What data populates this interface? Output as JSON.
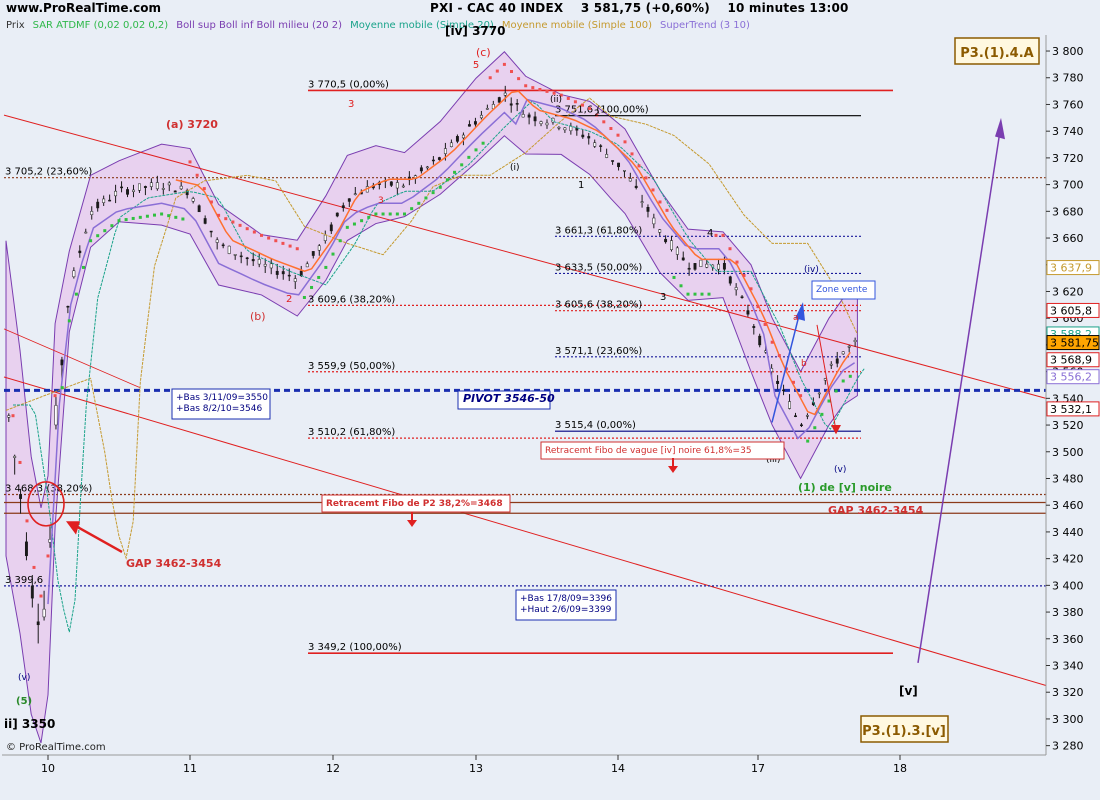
{
  "header": {
    "site": "www.ProRealTime.com",
    "symbol": "PXI - CAC 40 INDEX",
    "price_change": "3 581,75 (+0,60%)",
    "timeframe": "10 minutes 13:00"
  },
  "legend": [
    {
      "label": "Prix",
      "color": "#333333"
    },
    {
      "label": "SAR ATDMF (0,02 0,02 0,2)",
      "color": "#2fb84a"
    },
    {
      "label": "Boll sup Boll inf Boll milieu (20 2)",
      "color": "#7a3db0"
    },
    {
      "label": "Moyenne mobile (Simple 20)",
      "color": "#1aa38a"
    },
    {
      "label": "Moyenne mobile (Simple 100)",
      "color": "#c59a2f"
    },
    {
      "label": "SuperTrend (3 10)",
      "color": "#8a6fd6"
    }
  ],
  "colors": {
    "background": "#e9eef6",
    "candle": "#1a1a1a",
    "fibo_red": "#e02020",
    "fibo_blue": "#1a1a9a",
    "sar_red": "#f05050",
    "sar_green": "#30c040",
    "bollinger_fill": "#e7c9ee",
    "bollinger_line": "#7a3db0",
    "supertrend": "#8a6fd6",
    "ma20": "#1aa38a",
    "ma100": "#c59a2f",
    "price_line": "#ff7030"
  },
  "copyright": "© ProRealTime.com",
  "chart_data": {
    "type": "candlestick",
    "title": "PXI - CAC 40 INDEX",
    "xlabel": "",
    "ylabel": "",
    "x_ticks": [
      "10",
      "11",
      "12",
      "13",
      "14",
      "17",
      "18"
    ],
    "y_ticks": [
      3280,
      3300,
      3320,
      3340,
      3360,
      3380,
      3400,
      3420,
      3440,
      3460,
      3480,
      3500,
      3520,
      3540,
      3560,
      3580,
      3600,
      3620,
      3640,
      3660,
      3680,
      3700,
      3720,
      3740,
      3760,
      3780,
      3800
    ],
    "y_tick_labels": [
      "3 280",
      "3 300",
      "3 320",
      "3 340",
      "3 360",
      "3 380",
      "3 400",
      "3 420",
      "3 440",
      "3 460",
      "3 480",
      "3 500",
      "3 520",
      "3 540",
      "3 560",
      "3 580",
      "3 600",
      "3 620",
      "3 640",
      "3 660",
      "3 680",
      "3 700",
      "3 720",
      "3 740",
      "3 760",
      "3 780",
      "3 800"
    ],
    "ylim": [
      3273,
      3812
    ],
    "grid": false,
    "price_path": [
      [
        9.7,
        3540
      ],
      [
        9.8,
        3470
      ],
      [
        9.88,
        3400
      ],
      [
        9.95,
        3370
      ],
      [
        10.0,
        3400
      ],
      [
        10.05,
        3520
      ],
      [
        10.15,
        3620
      ],
      [
        10.3,
        3680
      ],
      [
        10.5,
        3695
      ],
      [
        10.8,
        3700
      ],
      [
        11.0,
        3695
      ],
      [
        11.2,
        3655
      ],
      [
        11.5,
        3640
      ],
      [
        11.75,
        3630
      ],
      [
        11.95,
        3660
      ],
      [
        12.1,
        3690
      ],
      [
        12.3,
        3700
      ],
      [
        12.5,
        3700
      ],
      [
        12.75,
        3720
      ],
      [
        13.0,
        3748
      ],
      [
        13.2,
        3768
      ],
      [
        13.35,
        3752
      ],
      [
        13.6,
        3745
      ],
      [
        13.8,
        3735
      ],
      [
        13.95,
        3720
      ],
      [
        14.05,
        3710
      ],
      [
        14.3,
        3665
      ],
      [
        14.5,
        3640
      ],
      [
        14.75,
        3640
      ],
      [
        14.95,
        3600
      ],
      [
        15.1,
        3560
      ],
      [
        15.3,
        3520
      ],
      [
        15.5,
        3560
      ],
      [
        15.6,
        3575
      ],
      [
        15.7,
        3582
      ]
    ],
    "horizontal_levels": [
      {
        "value": 3770.5,
        "label": "3 770,5 (0,00%)",
        "style": "solid",
        "color": "red"
      },
      {
        "value": 3751.6,
        "label": "3 751,6 (100,00%)",
        "style": "solid",
        "color": "black"
      },
      {
        "value": 3705.2,
        "label": "3 705,2 (23,60%)",
        "style": "dotted",
        "color": "brown"
      },
      {
        "value": 3661.3,
        "label": "3 661,3 (61,80%)",
        "style": "dotted",
        "color": "blue"
      },
      {
        "value": 3633.5,
        "label": "3 633,5 (50,00%)",
        "style": "dotted",
        "color": "blue"
      },
      {
        "value": 3609.6,
        "label": "3 609,6 (38,20%)",
        "style": "dotted",
        "color": "red"
      },
      {
        "value": 3605.6,
        "label": "3 605,6 (38,20%)",
        "style": "dotted",
        "color": "red"
      },
      {
        "value": 3571.1,
        "label": "3 571,1 (23,60%)",
        "style": "dotted",
        "color": "blue"
      },
      {
        "value": 3559.9,
        "label": "3 559,9 (50,00%)",
        "style": "dotted",
        "color": "red"
      },
      {
        "value": 3546,
        "label": "",
        "style": "pivot",
        "color": "blue"
      },
      {
        "value": 3515.4,
        "label": "3 515,4 (0,00%)",
        "style": "solid",
        "color": "navy"
      },
      {
        "value": 3510.2,
        "label": "3 510,2 (61,80%)",
        "style": "dotted",
        "color": "red"
      },
      {
        "value": 3468,
        "label": "3 468,3 (38,20%)",
        "style": "dotted",
        "color": "brown"
      },
      {
        "value": 3462,
        "label": "",
        "style": "solid",
        "color": "brown"
      },
      {
        "value": 3454,
        "label": "",
        "style": "solid",
        "color": "brown"
      },
      {
        "value": 3399.6,
        "label": "3 399,6",
        "style": "dotted",
        "color": "blue"
      },
      {
        "value": 3349.2,
        "label": "3 349,2 (100,00%)",
        "style": "solid",
        "color": "red"
      }
    ],
    "price_tags": [
      {
        "value": 3637.9,
        "label": "3 637,9",
        "border": "#c59a2f",
        "fill": "#ffffff",
        "text": "#c59a2f"
      },
      {
        "value": 3605.8,
        "label": "3 605,8",
        "border": "#e02020",
        "fill": "#ffffff",
        "text": "#000000"
      },
      {
        "value": 3588.2,
        "label": "3 588,2",
        "border": "#1aa38a",
        "fill": "#ffffff",
        "text": "#1aa38a"
      },
      {
        "value": 3581.75,
        "label": "3 581,75",
        "border": "#000000",
        "fill": "#ffa500",
        "text": "#000000"
      },
      {
        "value": 3568.9,
        "label": "3 568,9",
        "border": "#e02020",
        "fill": "#ffffff",
        "text": "#000000"
      },
      {
        "value": 3556.2,
        "label": "3 556,2",
        "border": "#8a6fd6",
        "fill": "#ffffff",
        "text": "#8a6fd6"
      },
      {
        "value": 3532.1,
        "label": "3 532,1",
        "border": "#e02020",
        "fill": "#ffffff",
        "text": "#000000"
      }
    ],
    "annotations": {
      "wave_iv_top": "[iv] 3770",
      "wave_c": "(c)",
      "five_top": "5",
      "a_3720": "(a) 3720",
      "b_label": "(b)",
      "three_a": "3",
      "two_a": "2",
      "three_b": "3",
      "ii_label": "(ii)",
      "i_label": "(i)",
      "one_label": "1",
      "two_b": "2",
      "four_label": "4",
      "three_c": "3",
      "iv_label": "(iv)",
      "a_small": "a",
      "b_small": "b",
      "five_bottom": "5",
      "iii_label": "(iii)",
      "v_small": "(v)",
      "v_left": "(v)",
      "five_left": "(5)",
      "ii_3350": "ii] 3350",
      "zone_vente": "Zone vente",
      "pivot": "PIVOT 3546-50",
      "bas_box_1": "+Bas 3/11/09=3550",
      "bas_box_2": "+Bas 8/2/10=3546",
      "bas2_box_1": "+Bas 17/8/09=3396",
      "bas2_box_2": "+Haut 2/6/09=3399",
      "retracement_v": "Retracemt Fibo de vague [iv] noire 61,8%=35",
      "retracement_p2": "Retracemt Fibo de P2 38,2%=3468",
      "one_v_noire": "(1) de [v] noire",
      "gap_right": "GAP 3462-3454",
      "gap_left": "GAP 3462-3454",
      "p3_top": "P3.(1).4.A",
      "p3_bottom": "P3.(1).3.[v]",
      "v_bracket": "[v]"
    }
  }
}
